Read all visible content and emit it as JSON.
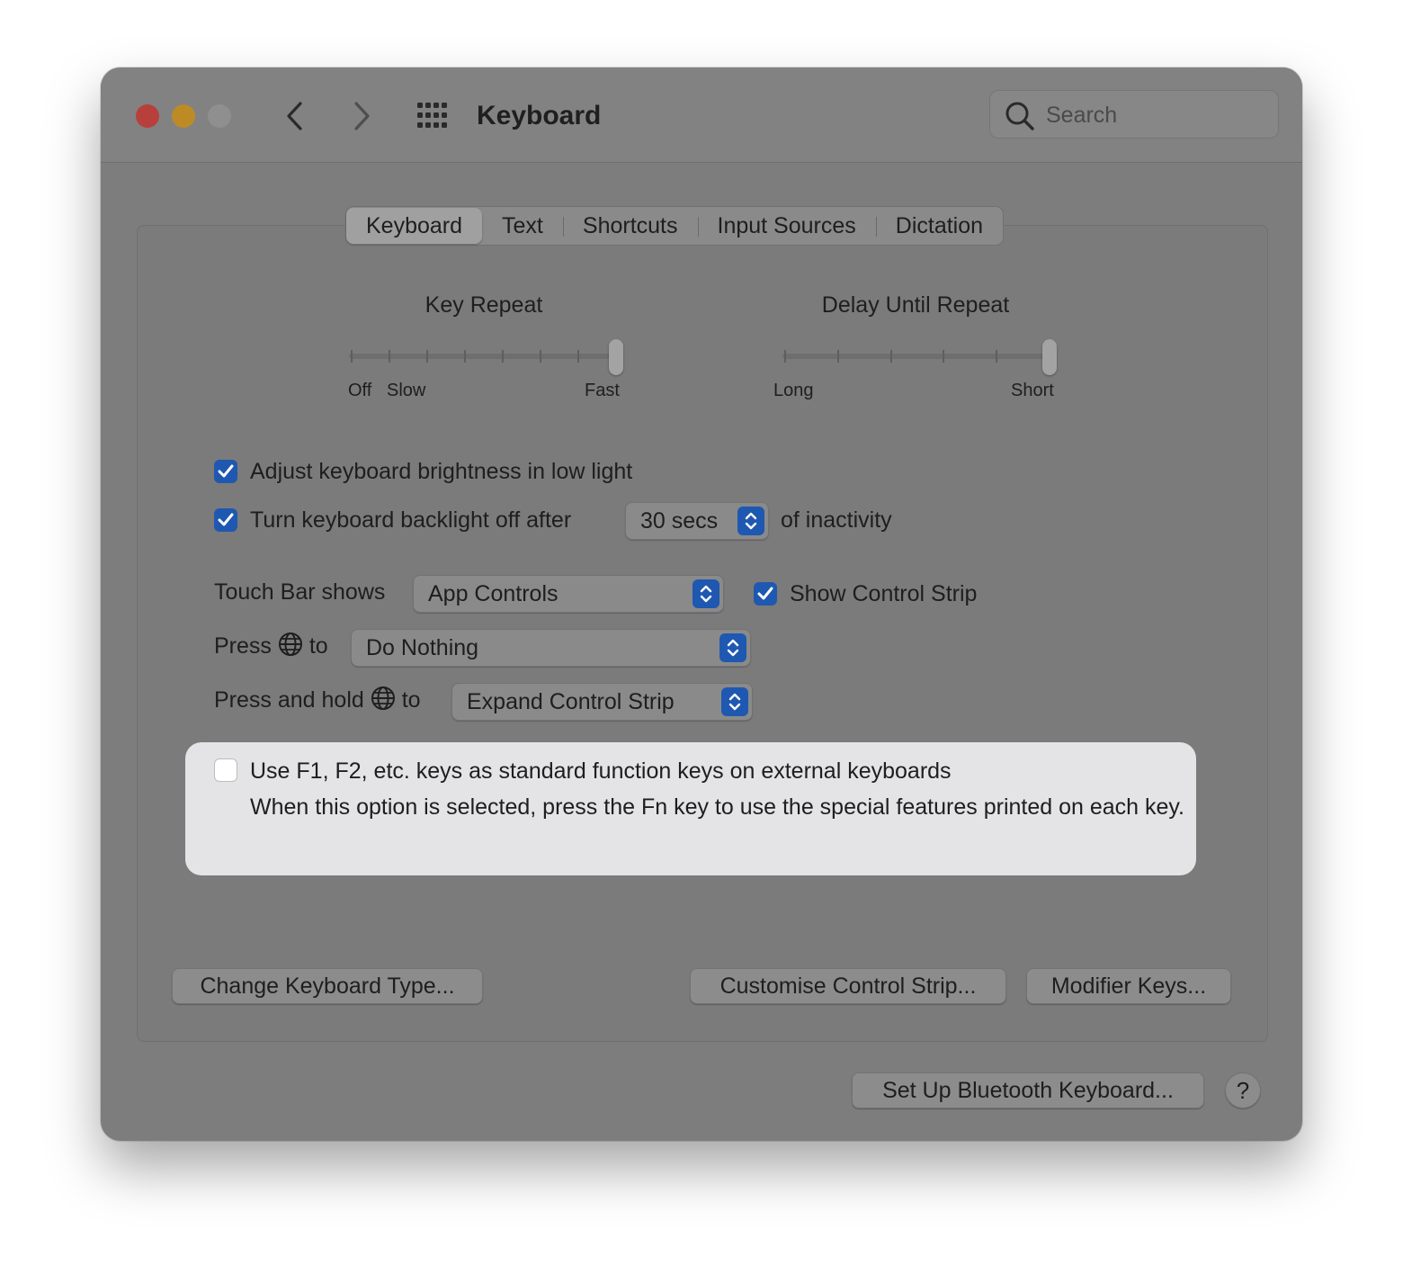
{
  "window": {
    "title": "Keyboard",
    "search_placeholder": "Search"
  },
  "tabs": [
    {
      "label": "Keyboard",
      "active": true
    },
    {
      "label": "Text",
      "active": false
    },
    {
      "label": "Shortcuts",
      "active": false
    },
    {
      "label": "Input Sources",
      "active": false
    },
    {
      "label": "Dictation",
      "active": false
    }
  ],
  "key_repeat": {
    "title": "Key Repeat",
    "labels": {
      "off": "Off",
      "slow": "Slow",
      "fast": "Fast"
    },
    "steps": 8,
    "value_step": 7
  },
  "delay_until_repeat": {
    "title": "Delay Until Repeat",
    "labels": {
      "long": "Long",
      "short": "Short"
    },
    "steps": 6,
    "value_step": 5
  },
  "options": {
    "adjust_brightness": {
      "label": "Adjust keyboard brightness in low light",
      "checked": true
    },
    "backlight_off": {
      "label": "Turn keyboard backlight off after",
      "checked": true,
      "value": "30 secs",
      "suffix": "of inactivity"
    },
    "touch_bar": {
      "label": "Touch Bar shows",
      "value": "App Controls"
    },
    "show_control_strip": {
      "label": "Show Control Strip",
      "checked": true
    },
    "press_globe": {
      "label_before": "Press",
      "label_after": "to",
      "value": "Do Nothing"
    },
    "press_hold_globe": {
      "label_before": "Press and hold",
      "label_after": "to",
      "value": "Expand Control Strip"
    },
    "function_keys": {
      "label": "Use F1, F2, etc. keys as standard function keys on external keyboards",
      "description": "When this option is selected, press the Fn key to use the special features printed on each key.",
      "checked": false
    }
  },
  "buttons": {
    "change_keyboard_type": "Change Keyboard Type...",
    "customise_control_strip": "Customise Control Strip...",
    "modifier_keys": "Modifier Keys...",
    "bluetooth_keyboard": "Set Up Bluetooth Keyboard...",
    "help": "?"
  },
  "colors": {
    "accent": "#1f58b0",
    "close": "#b7403c",
    "minimize": "#bd8b25"
  }
}
